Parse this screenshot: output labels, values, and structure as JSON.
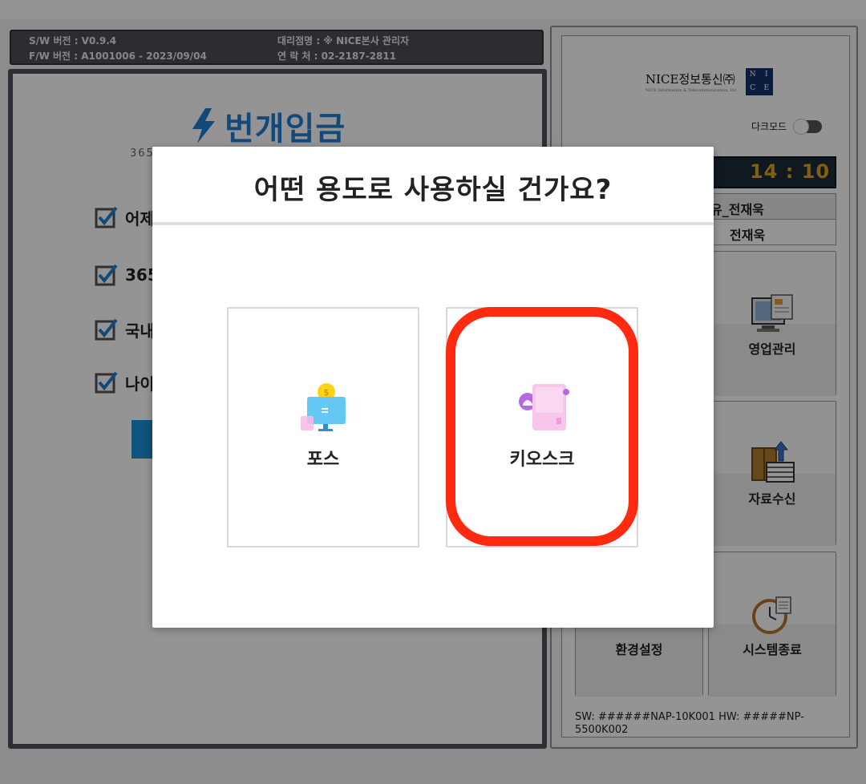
{
  "info_bar": {
    "sw_version": "S/W 버전 : V0.9.4",
    "fw_version": "F/W 버전 : A1001006 - 2023/09/04",
    "agency": "대리점명 : ※ NICE본사 관리자",
    "contact": "연 락 처 : 02-2187-2811"
  },
  "left_panel": {
    "brand": "번개입금",
    "subtitle": "365",
    "checklist": [
      "어제",
      "365",
      "국내",
      "나이"
    ]
  },
  "right_panel": {
    "company": "NICE정보통신㈜",
    "company_sub": "NICE Information & Telecommunication, Inc.",
    "logo_letters": [
      "N",
      "I",
      "C",
      "E"
    ],
    "dark_mode_label": "다크모드",
    "clock": "14 : 10",
    "user_line1": "유_전재욱",
    "user_line2": "전재욱",
    "tiles": {
      "sales": "영업관리",
      "data": "자료수신",
      "settings": "환경설정",
      "shutdown": "시스템종료"
    },
    "footer": "SW: ######NAP-10K001      HW: #####NP-5500K002"
  },
  "modal": {
    "title": "어떤 용도로 사용하실 건가요?",
    "options": [
      {
        "label": "포스",
        "icon": "pos-monitor-icon"
      },
      {
        "label": "키오스크",
        "icon": "kiosk-icon"
      }
    ]
  },
  "colors": {
    "brand_blue": "#1f7fd0",
    "highlight_red": "#ff2a0f",
    "clock_amber": "#d9a51d",
    "nice_navy": "#14336b"
  }
}
